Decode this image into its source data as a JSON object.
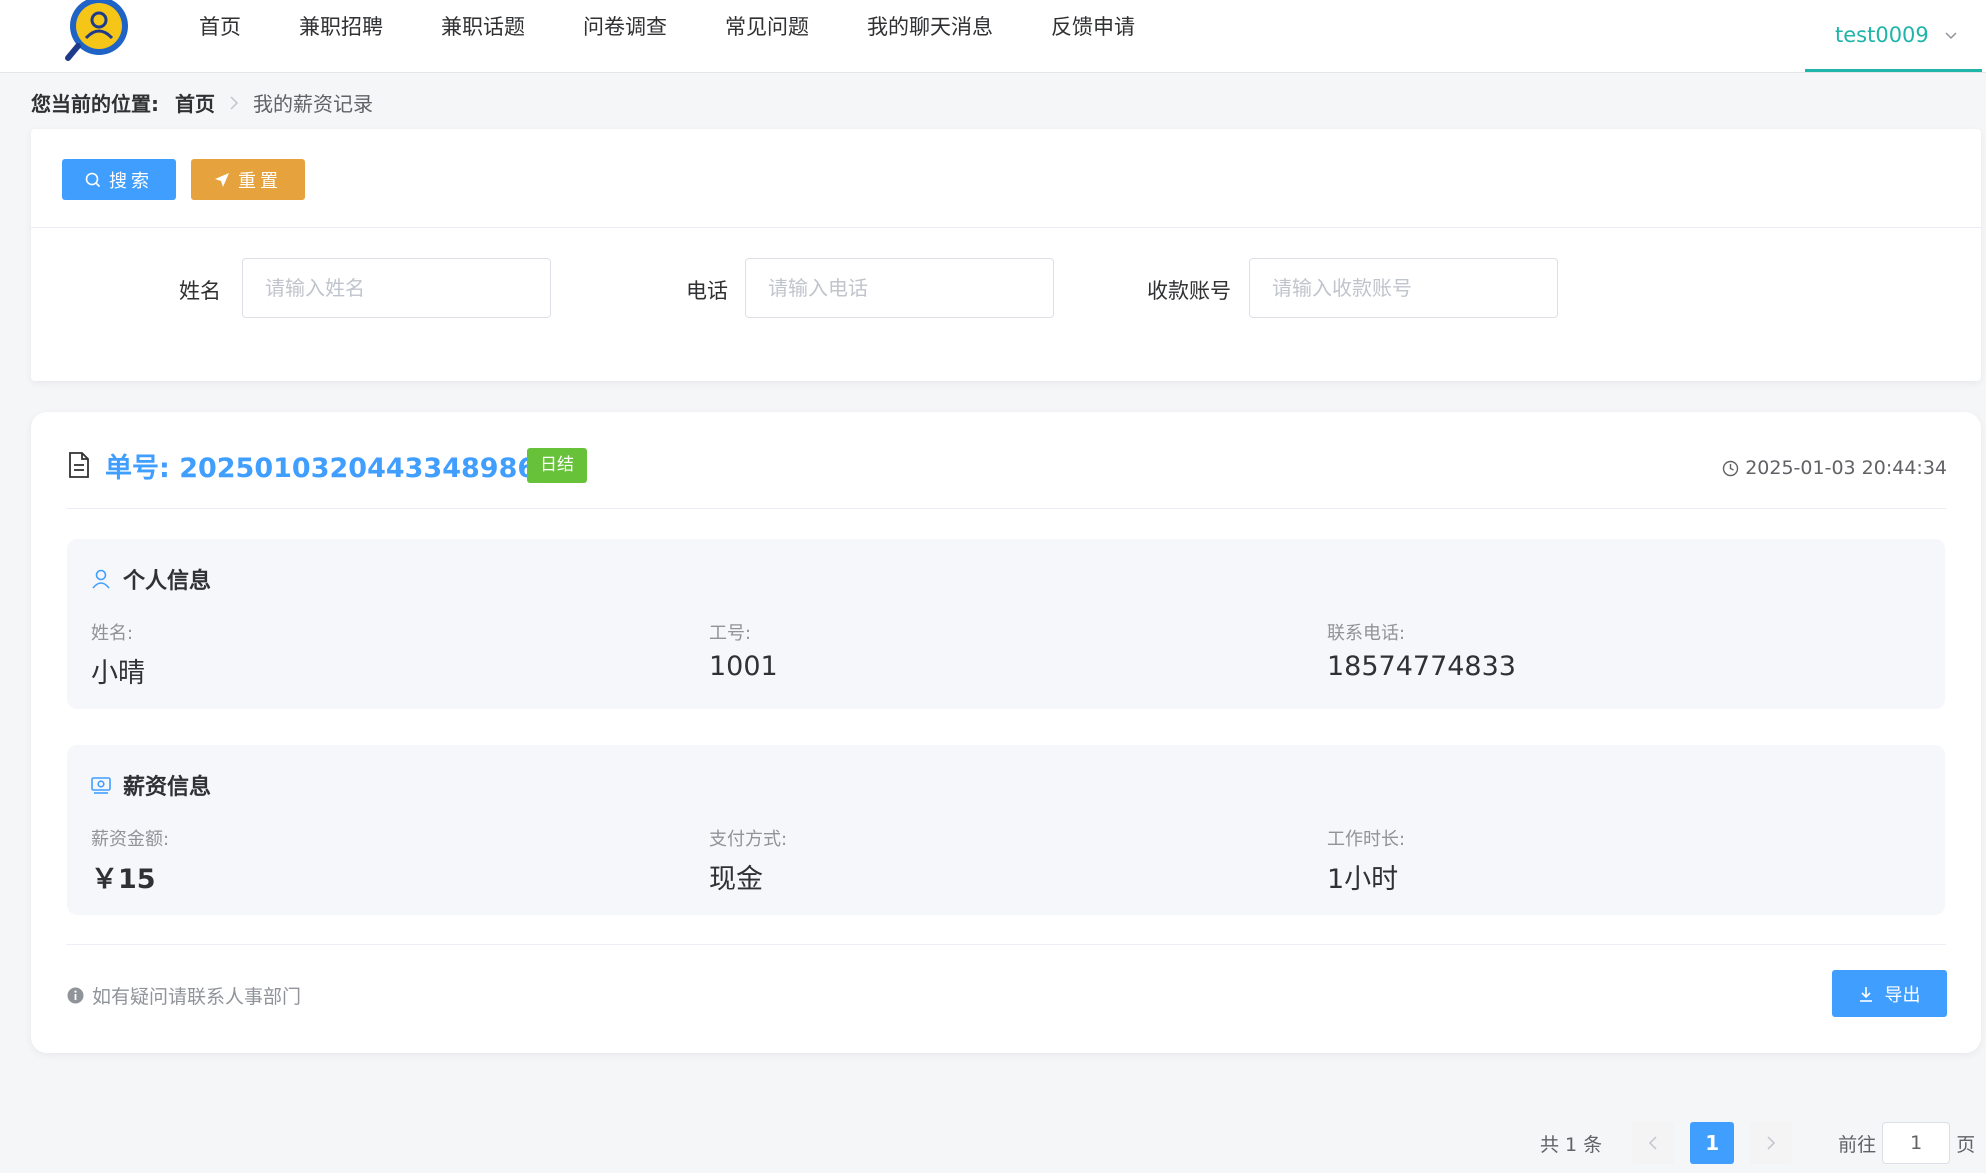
{
  "nav": {
    "items": [
      "首页",
      "兼职招聘",
      "兼职话题",
      "问卷调查",
      "常见问题",
      "我的聊天消息",
      "反馈申请"
    ],
    "username": "test0009"
  },
  "breadcrumb": {
    "label": "您当前的位置:",
    "home": "首页",
    "current": "我的薪资记录"
  },
  "search": {
    "search_label": "搜索",
    "reset_label": "重置",
    "name_label": "姓名",
    "name_placeholder": "请输入姓名",
    "phone_label": "电话",
    "phone_placeholder": "请输入电话",
    "account_label": "收款账号",
    "account_placeholder": "请输入收款账号"
  },
  "record": {
    "order_no": "单号: 20250103204433489865",
    "status": "日结",
    "time": "2025-01-03 20:44:34",
    "personal": {
      "title": "个人信息",
      "name_label": "姓名:",
      "name_value": "小晴",
      "id_label": "工号:",
      "id_value": "1001",
      "phone_label": "联系电话:",
      "phone_value": "18574774833"
    },
    "salary": {
      "title": "薪资信息",
      "amount_label": "薪资金额:",
      "amount_value": "￥15",
      "method_label": "支付方式:",
      "method_value": "现金",
      "hours_label": "工作时长:",
      "hours_value": "1小时"
    },
    "note": "如有疑问请联系人事部门",
    "export_label": "导出"
  },
  "pagination": {
    "total": "共 1 条",
    "current_page": "1",
    "goto_label": "前往",
    "goto_value": "1",
    "page_suffix": "页"
  },
  "colors": {
    "primary": "#409eff",
    "warning": "#e6a23c",
    "success": "#67c23a",
    "accent": "#1fb5a8"
  }
}
